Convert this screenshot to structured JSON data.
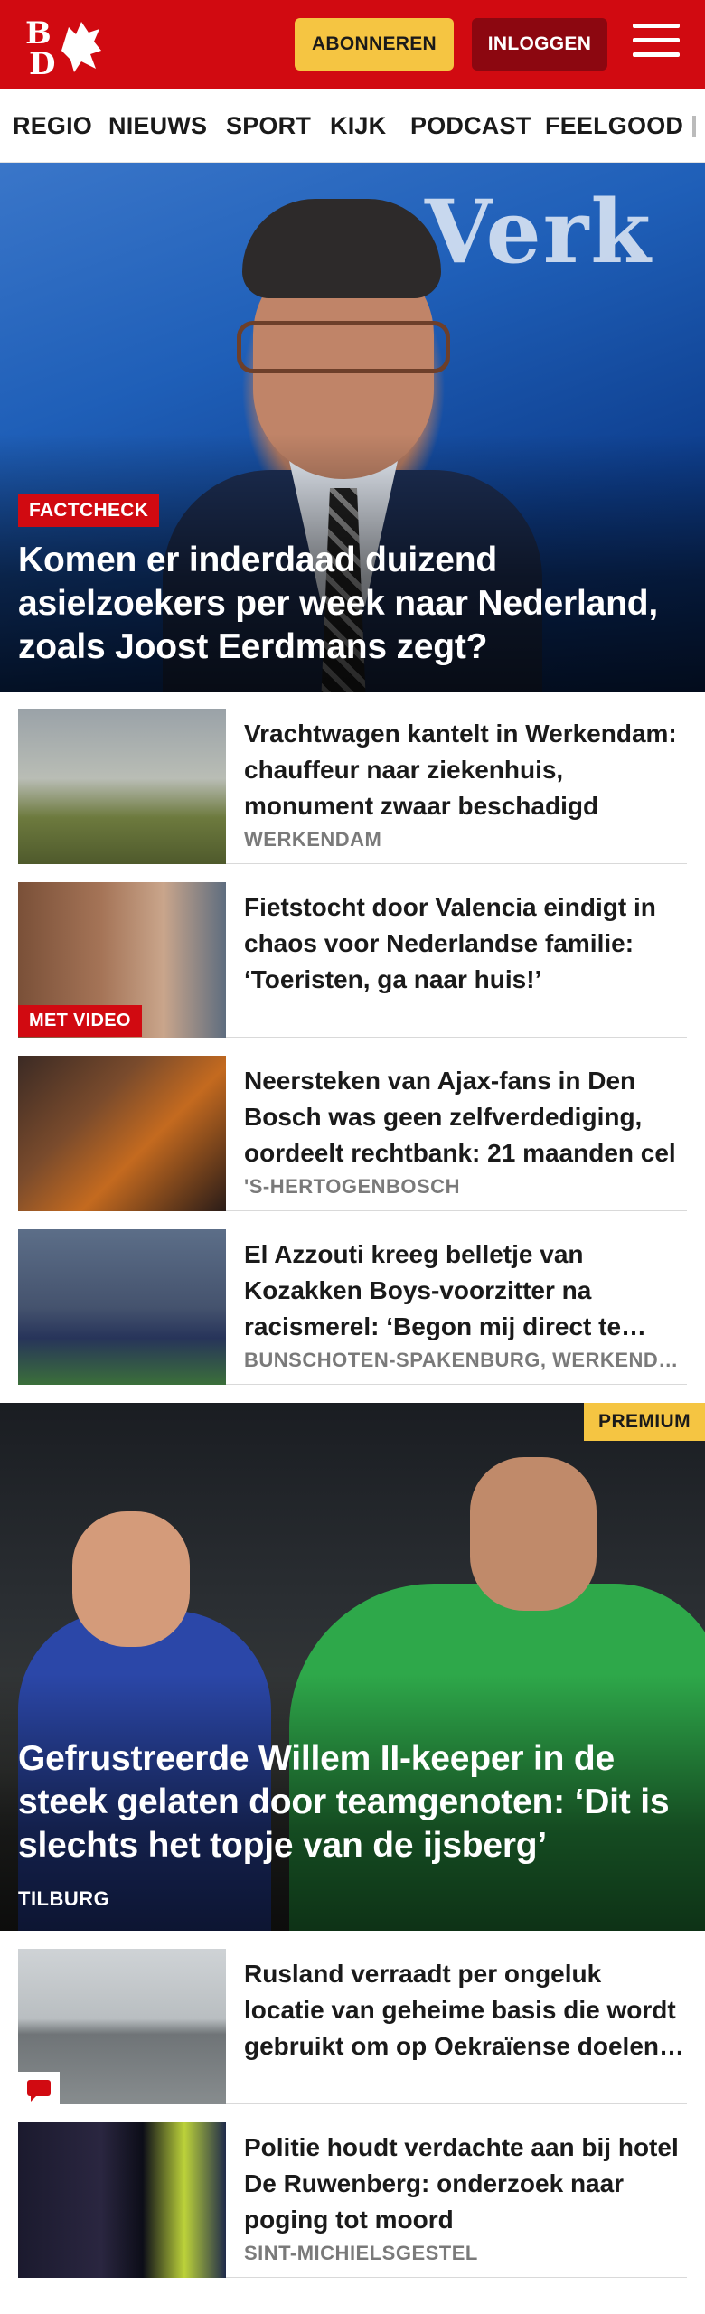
{
  "header": {
    "logo_text": "BD",
    "subscribe_label": "ABONNEREN",
    "login_label": "INLOGGEN",
    "brand_color": "#d10a11",
    "icons": [
      "bd-logo-icon",
      "hamburger-menu-icon"
    ]
  },
  "nav": {
    "items": [
      {
        "label": "REGIO"
      },
      {
        "label": "NIEUWS"
      },
      {
        "label": "SPORT"
      },
      {
        "label": "KIJK"
      },
      {
        "label": "PODCAST"
      },
      {
        "label": "FEELGOOD"
      }
    ]
  },
  "hero": {
    "background_text": "Verk",
    "tag": "FACTCHECK",
    "title": "Komen er inderdaad duizend asielzoekers per week naar Nederland, zoals Joost Eerdmans zegt?"
  },
  "articles": [
    {
      "title": "Vrachtwagen kantelt in Werkendam: chauffeur naar ziekenhuis, monument zwaar beschadigd",
      "location": "WERKENDAM",
      "badge": ""
    },
    {
      "title": "Fietstocht door Valencia eindigt in chaos voor Nederlandse familie: ‘Toeristen, ga naar huis!’",
      "location": "",
      "badge": "MET VIDEO"
    },
    {
      "title": "Neersteken van Ajax-fans in Den Bosch was geen zelfverdediging, oordeelt rechtbank: 21 maanden cel",
      "location": "'S-HERTOGENBOSCH",
      "badge": ""
    },
    {
      "title": "El Azzouti kreeg belletje van Kozakken Boys-voorzitter na racismerel: ‘Begon mij direct te verontschuldigen’",
      "location": "BUNSCHOTEN-SPAKENBURG, WERKENDAM",
      "badge": ""
    }
  ],
  "feature": {
    "tag": "PREMIUM",
    "title": "Gefrustreerde Willem II-keeper in de steek gelaten door teamgenoten: ‘Dit is slechts het topje van de ijsberg’",
    "location": "TILBURG"
  },
  "articles2": [
    {
      "title": "Rusland verraadt per ongeluk locatie van geheime basis die wordt gebruikt om op Oekraïense doelen te schieten",
      "location": "",
      "badge_icon": "comment-icon"
    },
    {
      "title": "Politie houdt verdachte aan bij hotel De Ruwenberg: onderzoek naar poging tot moord",
      "location": "SINT-MICHIELSGESTEL"
    }
  ]
}
